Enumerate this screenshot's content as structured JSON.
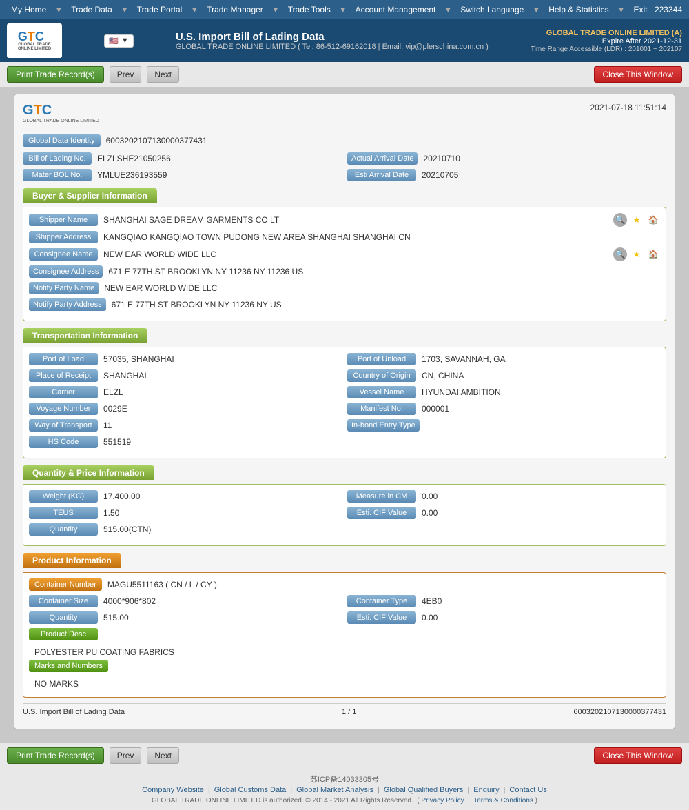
{
  "topnav": {
    "items": [
      "My Home",
      "Trade Data",
      "Trade Portal",
      "Trade Manager",
      "Trade Tools",
      "Account Management",
      "Switch Language",
      "Help & Statistics",
      "Exit"
    ],
    "account_number": "223344"
  },
  "header": {
    "logo_text": "GTC",
    "logo_sub": "GLOBAL TRADE ONLINE LIMITED",
    "title": "U.S. Import Bill of Lading Data",
    "subtitle": "GLOBAL TRADE ONLINE LIMITED ( Tel: 86-512-69162018 | Email: vip@plerschina.com.cn )",
    "company_name": "GLOBAL TRADE ONLINE LIMITED (A)",
    "expire": "Expire After 2021-12-31",
    "time_range": "Time Range Accessible (LDR) : 201001 ~ 202107"
  },
  "toolbar": {
    "print_label": "Print Trade Record(s)",
    "prev_label": "Prev",
    "next_label": "Next",
    "close_label": "Close This Window"
  },
  "record": {
    "date": "2021-07-18 11:51:14",
    "global_data_id_label": "Global Data Identity",
    "global_data_id_value": "6003202107130000377431",
    "bol_no_label": "Bill of Lading No.",
    "bol_no_value": "ELZLSHE21050256",
    "actual_arrival_date_label": "Actual Arrival Date",
    "actual_arrival_date_value": "20210710",
    "mater_bol_label": "Mater BOL No.",
    "mater_bol_value": "YMLUE236193559",
    "esti_arrival_date_label": "Esti Arrival Date",
    "esti_arrival_date_value": "20210705",
    "buyer_supplier_section": "Buyer & Supplier Information",
    "shipper_name_label": "Shipper Name",
    "shipper_name_value": "SHANGHAI SAGE DREAM GARMENTS CO LT",
    "shipper_address_label": "Shipper Address",
    "shipper_address_value": "KANGQIAO KANGQIAO TOWN PUDONG NEW AREA SHANGHAI SHANGHAI CN",
    "consignee_name_label": "Consignee Name",
    "consignee_name_value": "NEW EAR WORLD WIDE LLC",
    "consignee_address_label": "Consignee Address",
    "consignee_address_value": "671 E 77TH ST BROOKLYN NY 11236 NY 11236 US",
    "notify_party_name_label": "Notify Party Name",
    "notify_party_name_value": "NEW EAR WORLD WIDE LLC",
    "notify_party_address_label": "Notify Party Address",
    "notify_party_address_value": "671 E 77TH ST BROOKLYN NY 11236 NY US",
    "transportation_section": "Transportation Information",
    "port_load_label": "Port of Load",
    "port_load_value": "57035, SHANGHAI",
    "port_unload_label": "Port of Unload",
    "port_unload_value": "1703, SAVANNAH, GA",
    "place_receipt_label": "Place of Receipt",
    "place_receipt_value": "SHANGHAI",
    "country_origin_label": "Country of Origin",
    "country_origin_value": "CN, CHINA",
    "carrier_label": "Carrier",
    "carrier_value": "ELZL",
    "vessel_name_label": "Vessel Name",
    "vessel_name_value": "HYUNDAI AMBITION",
    "voyage_number_label": "Voyage Number",
    "voyage_number_value": "0029E",
    "manifest_no_label": "Manifest No.",
    "manifest_no_value": "000001",
    "way_of_transport_label": "Way of Transport",
    "way_of_transport_value": "11",
    "in_bond_label": "In-bond Entry Type",
    "in_bond_value": "",
    "hs_code_label": "HS Code",
    "hs_code_value": "551519",
    "quantity_section": "Quantity & Price Information",
    "weight_kg_label": "Weight (KG)",
    "weight_kg_value": "17,400.00",
    "measure_cm_label": "Measure in CM",
    "measure_cm_value": "0.00",
    "teus_label": "TEUS",
    "teus_value": "1.50",
    "esti_cif_label": "Esti. CIF Value",
    "esti_cif_value": "0.00",
    "quantity_label": "Quantity",
    "quantity_value": "515.00(CTN)",
    "product_section": "Product Information",
    "container_number_label": "Container Number",
    "container_number_value": "MAGU5511163 ( CN / L / CY )",
    "container_size_label": "Container Size",
    "container_size_value": "4000*906*802",
    "container_type_label": "Container Type",
    "container_type_value": "4EB0",
    "product_quantity_label": "Quantity",
    "product_quantity_value": "515.00",
    "product_esti_cif_label": "Esti. CIF Value",
    "product_esti_cif_value": "0.00",
    "product_desc_label": "Product Desc",
    "product_desc_value": "POLYESTER PU COATING FABRICS",
    "marks_numbers_label": "Marks and Numbers",
    "marks_numbers_value": "NO MARKS",
    "footer_title": "U.S. Import Bill of Lading Data",
    "footer_page": "1 / 1",
    "footer_id": "6003202107130000377431"
  },
  "footer": {
    "icp": "苏ICP备14033305号",
    "links": [
      "Company Website",
      "Global Customs Data",
      "Global Market Analysis",
      "Global Qualified Buyers",
      "Enquiry",
      "Contact Us"
    ],
    "copyright": "GLOBAL TRADE ONLINE LIMITED is authorized. © 2014 - 2021 All Rights Reserved.",
    "privacy_label": "Privacy Policy",
    "terms_label": "Terms & Conditions"
  }
}
